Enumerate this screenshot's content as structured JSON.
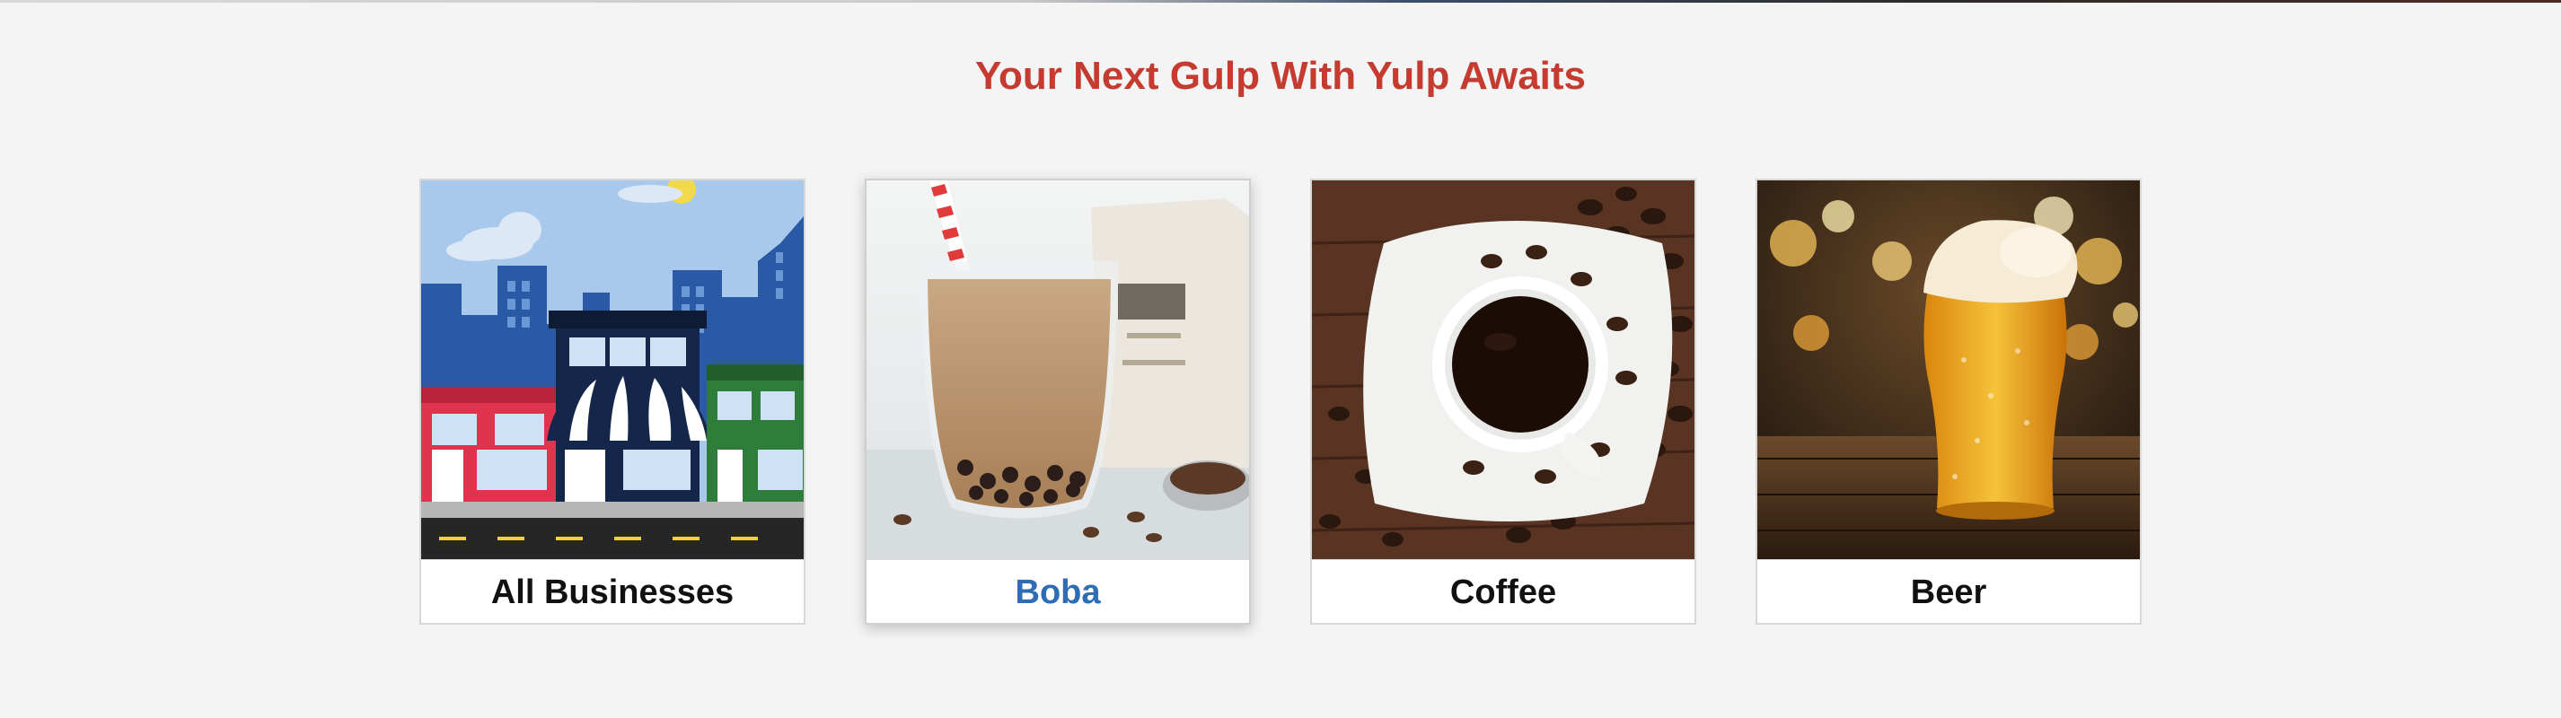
{
  "page": {
    "title": "Your Next Gulp With Yulp Awaits"
  },
  "categories": [
    {
      "label": "All Businesses",
      "image": "storefront-illustration",
      "selected": false
    },
    {
      "label": "Boba",
      "image": "boba-drink-photo",
      "selected": true
    },
    {
      "label": "Coffee",
      "image": "coffee-cup-photo",
      "selected": false
    },
    {
      "label": "Beer",
      "image": "beer-glass-photo",
      "selected": false
    }
  ],
  "colors": {
    "title": "#c53b30",
    "selected_label": "#2f6db2",
    "label": "#111111",
    "background": "#f4f4f4"
  }
}
